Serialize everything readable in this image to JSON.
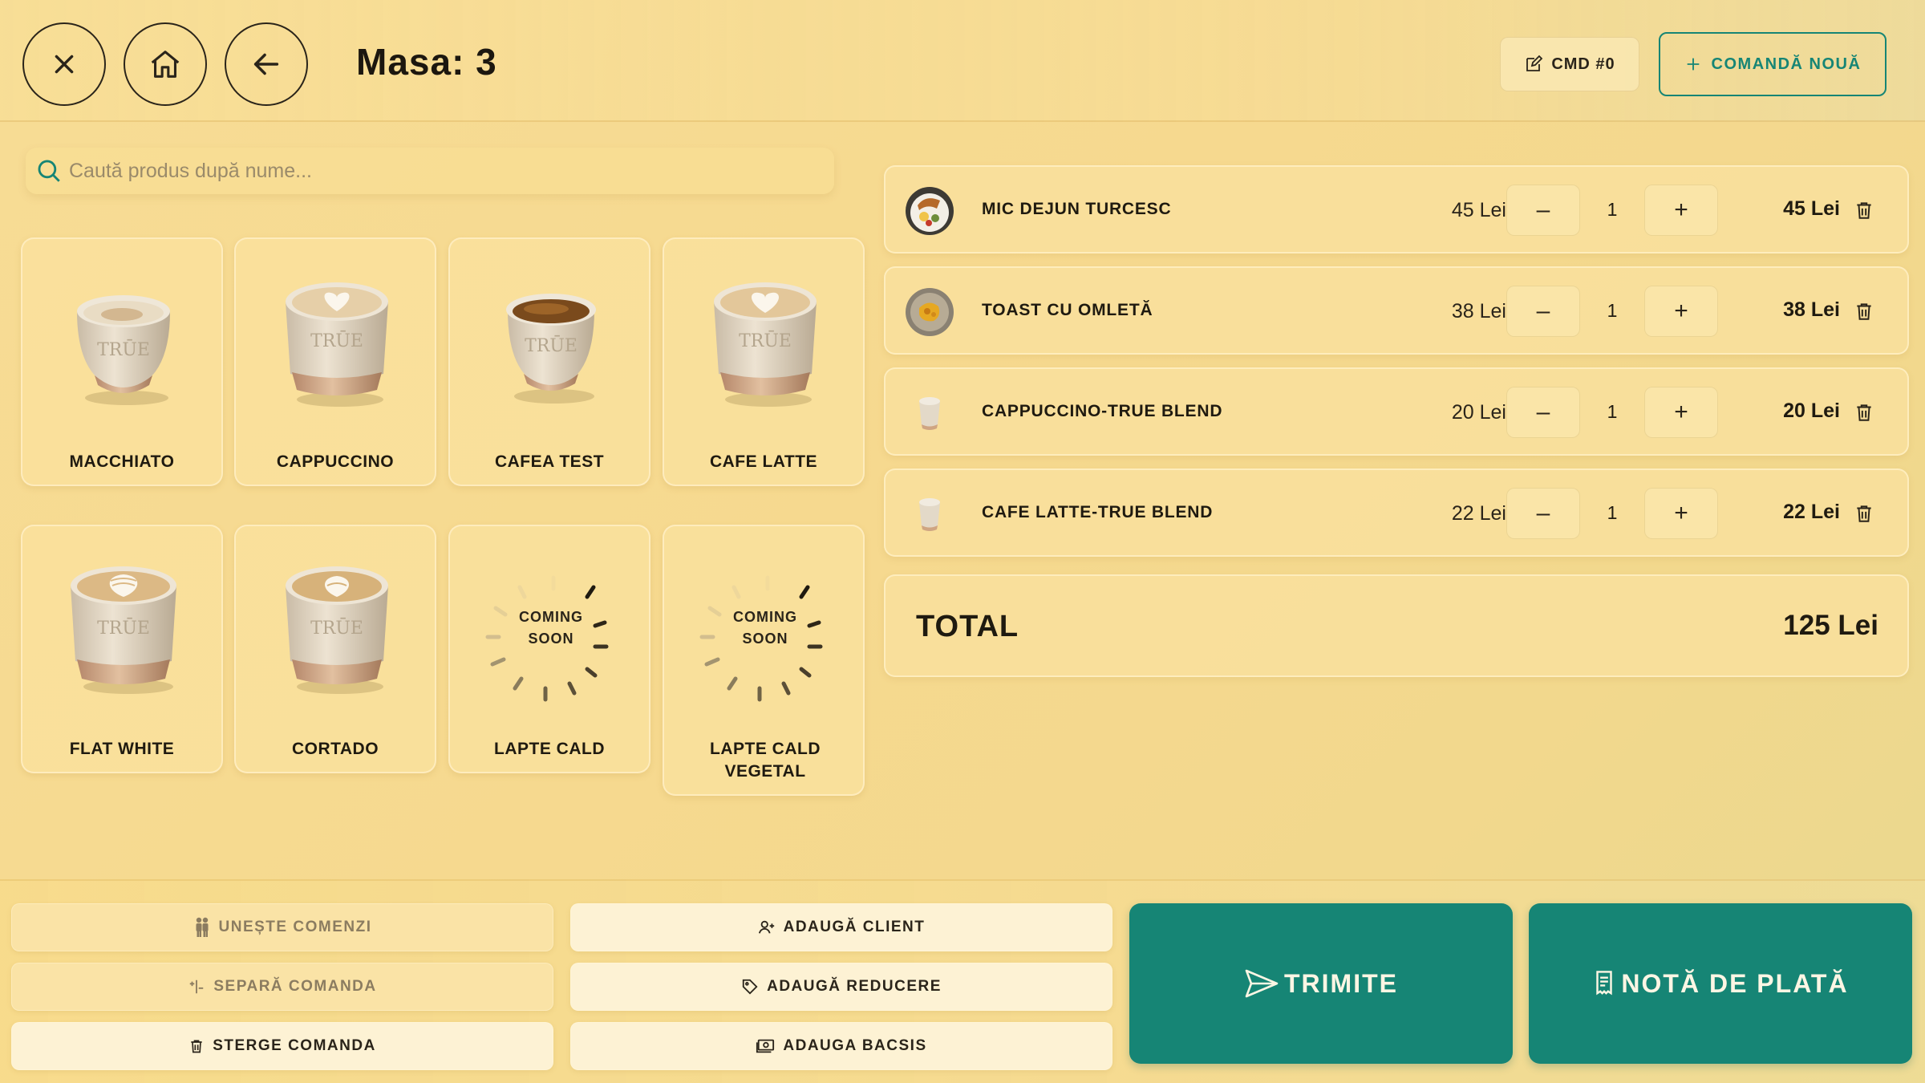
{
  "header": {
    "title": "Masa: 3",
    "close_icon": "close-icon",
    "home_icon": "home-icon",
    "back_icon": "arrow-left-icon",
    "cmd_label": "CMD #0",
    "new_order_label": "COMANDĂ NOUĂ"
  },
  "search": {
    "placeholder": "Caută produs după nume..."
  },
  "products": [
    {
      "name": "MACCHIATO",
      "image": "macchiato-cup"
    },
    {
      "name": "CAPPUCCINO",
      "image": "cappuccino-cup"
    },
    {
      "name": "CAFEA TEST",
      "image": "espresso-cup"
    },
    {
      "name": "CAFE LATTE",
      "image": "latte-cup"
    },
    {
      "name": "FLAT WHITE",
      "image": "flat-white-cup"
    },
    {
      "name": "CORTADO",
      "image": "cortado-cup"
    },
    {
      "name": "LAPTE CALD",
      "coming_soon": "COMING SOON"
    },
    {
      "name": "LAPTE CALD VEGETAL",
      "coming_soon": "COMING SOON"
    }
  ],
  "coming_soon": {
    "line1": "COMING",
    "line2": "SOON"
  },
  "cup_brand": "TRŪE",
  "order": {
    "items": [
      {
        "name": "MIC DEJUN TURCESC",
        "price": "45 Lei",
        "qty": "1",
        "total": "45 Lei"
      },
      {
        "name": "TOAST CU OMLETĂ",
        "price": "38 Lei",
        "qty": "1",
        "total": "38 Lei"
      },
      {
        "name": "CAPPUCCINO-TRUE BLEND",
        "price": "20 Lei",
        "qty": "1",
        "total": "20 Lei"
      },
      {
        "name": "CAFE LATTE-TRUE BLEND",
        "price": "22 Lei",
        "qty": "1",
        "total": "22 Lei"
      }
    ],
    "minus_label": "–",
    "plus_label": "+",
    "total_label": "TOTAL",
    "total_value": "125 Lei"
  },
  "footer": {
    "merge_orders": "UNEȘTE COMENZI",
    "split_order": "SEPARĂ COMANDA",
    "delete_order": "STERGE COMANDA",
    "add_client": "ADAUGĂ CLIENT",
    "add_discount": "ADAUGĂ REDUCERE",
    "add_tip": "ADAUGA BACSIS",
    "send": "TRIMITE",
    "bill": "NOTĂ DE PLATĂ"
  },
  "colors": {
    "accent": "#168575",
    "background": "#f7dc95",
    "card": "#f9e09c",
    "text": "#1f1a10"
  }
}
